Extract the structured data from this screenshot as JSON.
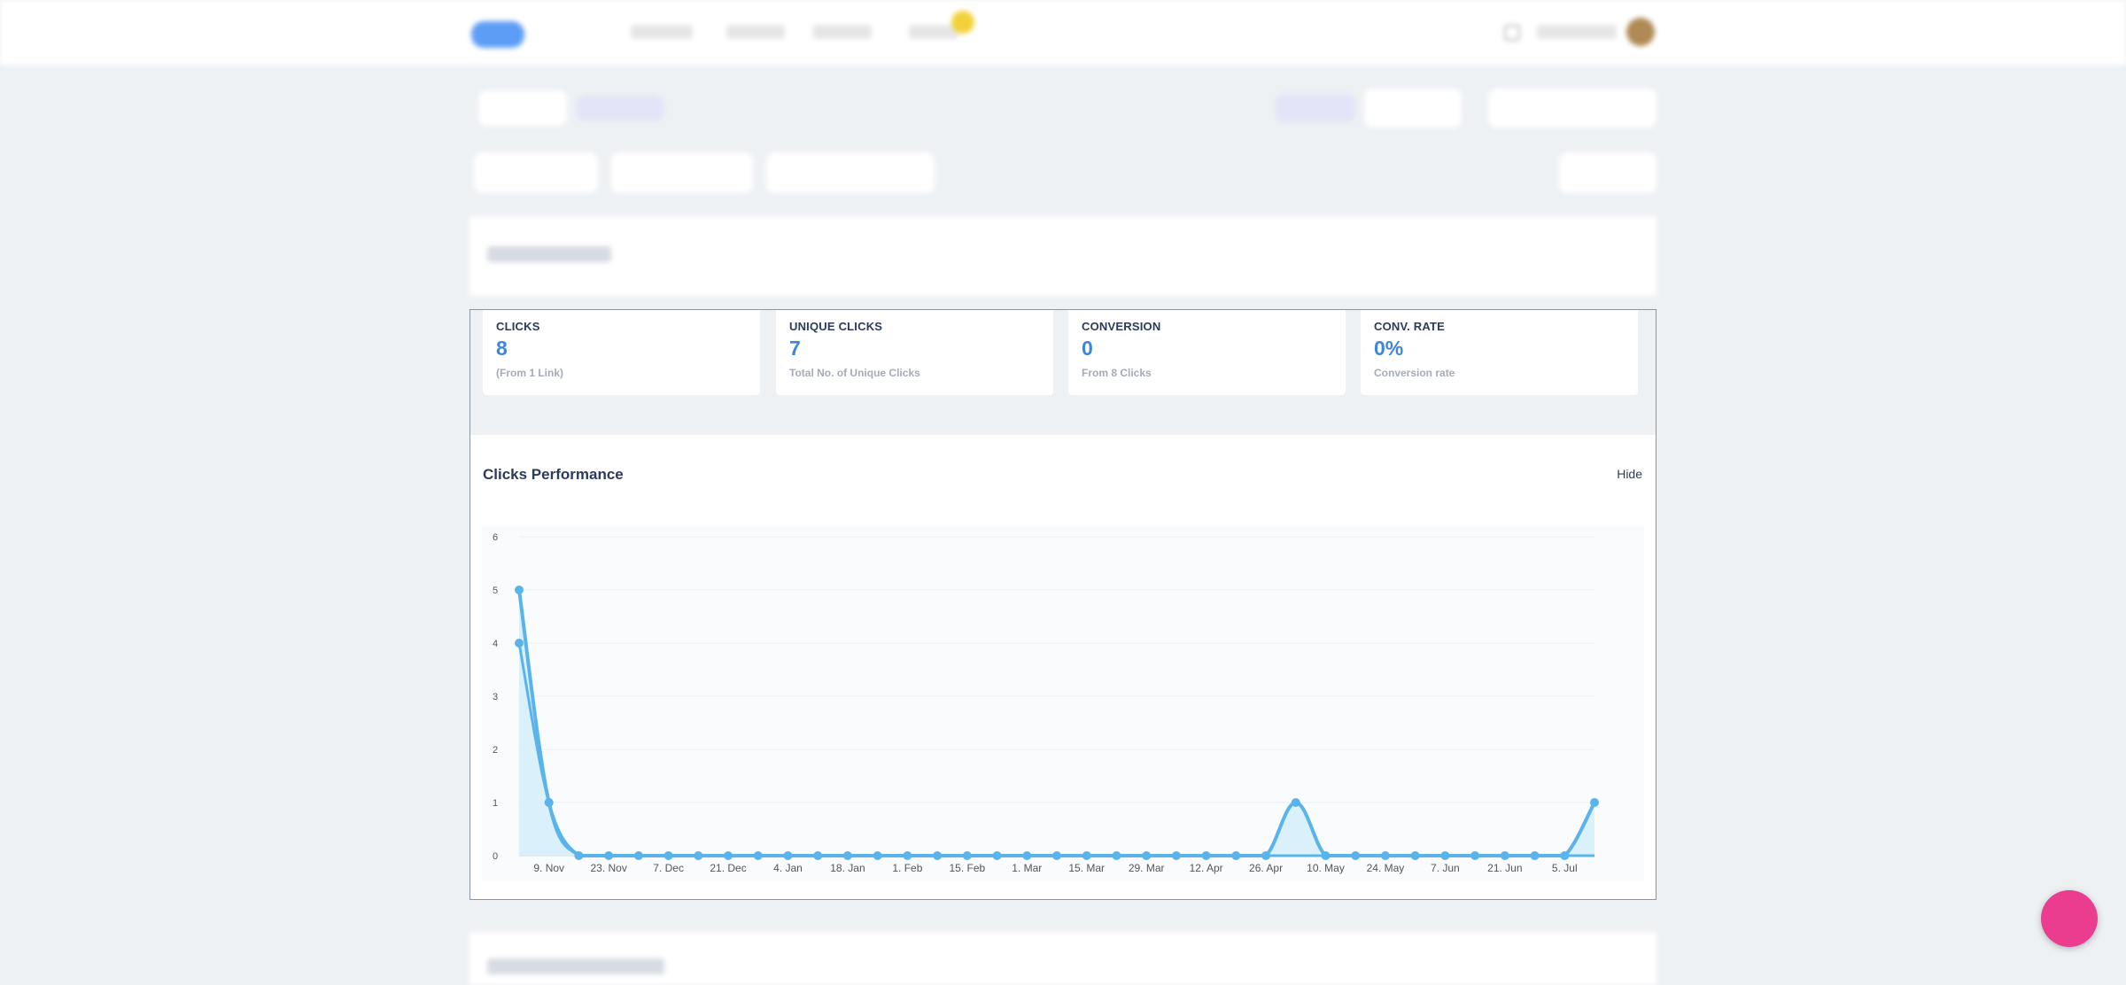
{
  "stats": [
    {
      "label": "CLICKS",
      "value": "8",
      "sub": "(From 1 Link)"
    },
    {
      "label": "UNIQUE CLICKS",
      "value": "7",
      "sub": "Total No. of Unique Clicks"
    },
    {
      "label": "CONVERSION",
      "value": "0",
      "sub": "From 8 Clicks"
    },
    {
      "label": "CONV. RATE",
      "value": "0%",
      "sub": "Conversion rate"
    }
  ],
  "perf": {
    "title": "Clicks Performance",
    "hide_label": "Hide"
  },
  "colors": {
    "accent": "#3d86e0",
    "line": "#5ab4ec",
    "area": "#d6f0fb",
    "fab": "#ea3d8f"
  },
  "chart_data": {
    "type": "line",
    "x_tick_labels": [
      "9. Nov",
      "23. Nov",
      "7. Dec",
      "21. Dec",
      "4. Jan",
      "18. Jan",
      "1. Feb",
      "15. Feb",
      "1. Mar",
      "15. Mar",
      "29. Mar",
      "12. Apr",
      "26. Apr",
      "10. May",
      "24. May",
      "7. Jun",
      "21. Jun",
      "5. Jul"
    ],
    "y_ticks": [
      0,
      1,
      2,
      3,
      4,
      5,
      6
    ],
    "ylim": [
      0,
      6
    ],
    "x_start": "2 Nov",
    "x_end": "5 Jul",
    "series": [
      {
        "values": [
          4,
          1,
          0,
          0,
          0,
          0,
          0,
          0,
          0,
          0,
          0,
          0,
          0,
          0,
          0,
          0,
          0,
          0,
          0,
          0,
          0,
          0,
          0,
          0,
          0,
          0,
          0,
          0,
          0,
          0,
          0,
          0,
          0,
          0,
          0,
          0,
          0
        ]
      },
      {
        "values": [
          5,
          1,
          0,
          0,
          0,
          0,
          0,
          0,
          0,
          0,
          0,
          0,
          0,
          0,
          0,
          0,
          0,
          0,
          0,
          0,
          0,
          0,
          0,
          0,
          0,
          0,
          1,
          0,
          0,
          0,
          0,
          0,
          0,
          0,
          0,
          0,
          1
        ]
      }
    ]
  }
}
